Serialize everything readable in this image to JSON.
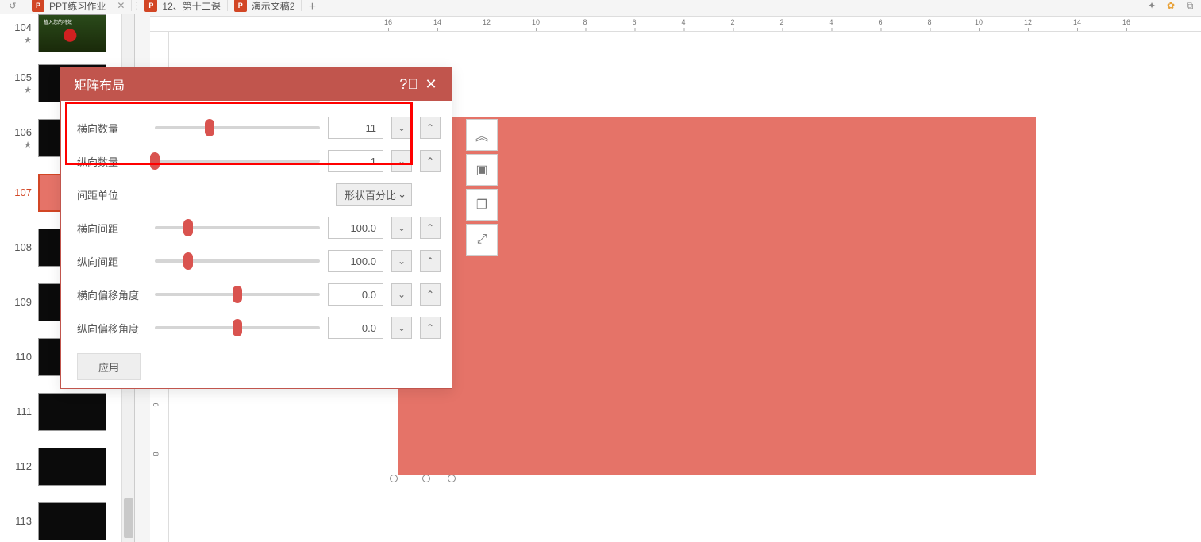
{
  "tabs": {
    "items": [
      {
        "label": "PPT练习作业",
        "has_close": true
      },
      {
        "label": "12、第十二课",
        "has_close": false
      },
      {
        "label": "演示文稿2",
        "has_close": false
      }
    ]
  },
  "ruler": {
    "h_ticks": [
      "16",
      "14",
      "12",
      "10",
      "8",
      "6",
      "4",
      "2",
      "2",
      "4",
      "6",
      "8",
      "10",
      "12",
      "14",
      "16"
    ],
    "v_ticks": [
      "6",
      "8"
    ]
  },
  "thumbnails": {
    "items": [
      {
        "num": "104",
        "star": true,
        "kind": "motorbike",
        "tiny": "植入您的特效",
        "selected": false
      },
      {
        "num": "105",
        "star": true,
        "kind": "black",
        "selected": false
      },
      {
        "num": "106",
        "star": true,
        "kind": "black",
        "selected": false
      },
      {
        "num": "107",
        "star": false,
        "kind": "red",
        "selected": true
      },
      {
        "num": "108",
        "star": false,
        "kind": "black",
        "selected": false
      },
      {
        "num": "109",
        "star": false,
        "kind": "black",
        "selected": false
      },
      {
        "num": "110",
        "star": false,
        "kind": "black",
        "selected": false
      },
      {
        "num": "111",
        "star": false,
        "kind": "black",
        "selected": false
      },
      {
        "num": "112",
        "star": false,
        "kind": "black",
        "selected": false
      },
      {
        "num": "113",
        "star": false,
        "kind": "black",
        "selected": false
      }
    ]
  },
  "dialog": {
    "title": "矩阵布局",
    "rows": {
      "h_count": {
        "label": "横向数量",
        "value": "11",
        "knob_pct": 33
      },
      "v_count": {
        "label": "纵向数量",
        "value": "1",
        "knob_pct": 0
      },
      "unit": {
        "label": "间距单位",
        "value": "形状百分比"
      },
      "h_gap": {
        "label": "横向间距",
        "value": "100.0",
        "knob_pct": 20
      },
      "v_gap": {
        "label": "纵向间距",
        "value": "100.0",
        "knob_pct": 20
      },
      "h_offset": {
        "label": "横向偏移角度",
        "value": "0.0",
        "knob_pct": 50
      },
      "v_offset": {
        "label": "纵向偏移角度",
        "value": "0.0",
        "knob_pct": 50
      }
    },
    "apply_label": "应用"
  },
  "mini_toolbar": {
    "items": [
      "collapse-up",
      "align-center",
      "duplicate",
      "expand-arrow"
    ]
  }
}
